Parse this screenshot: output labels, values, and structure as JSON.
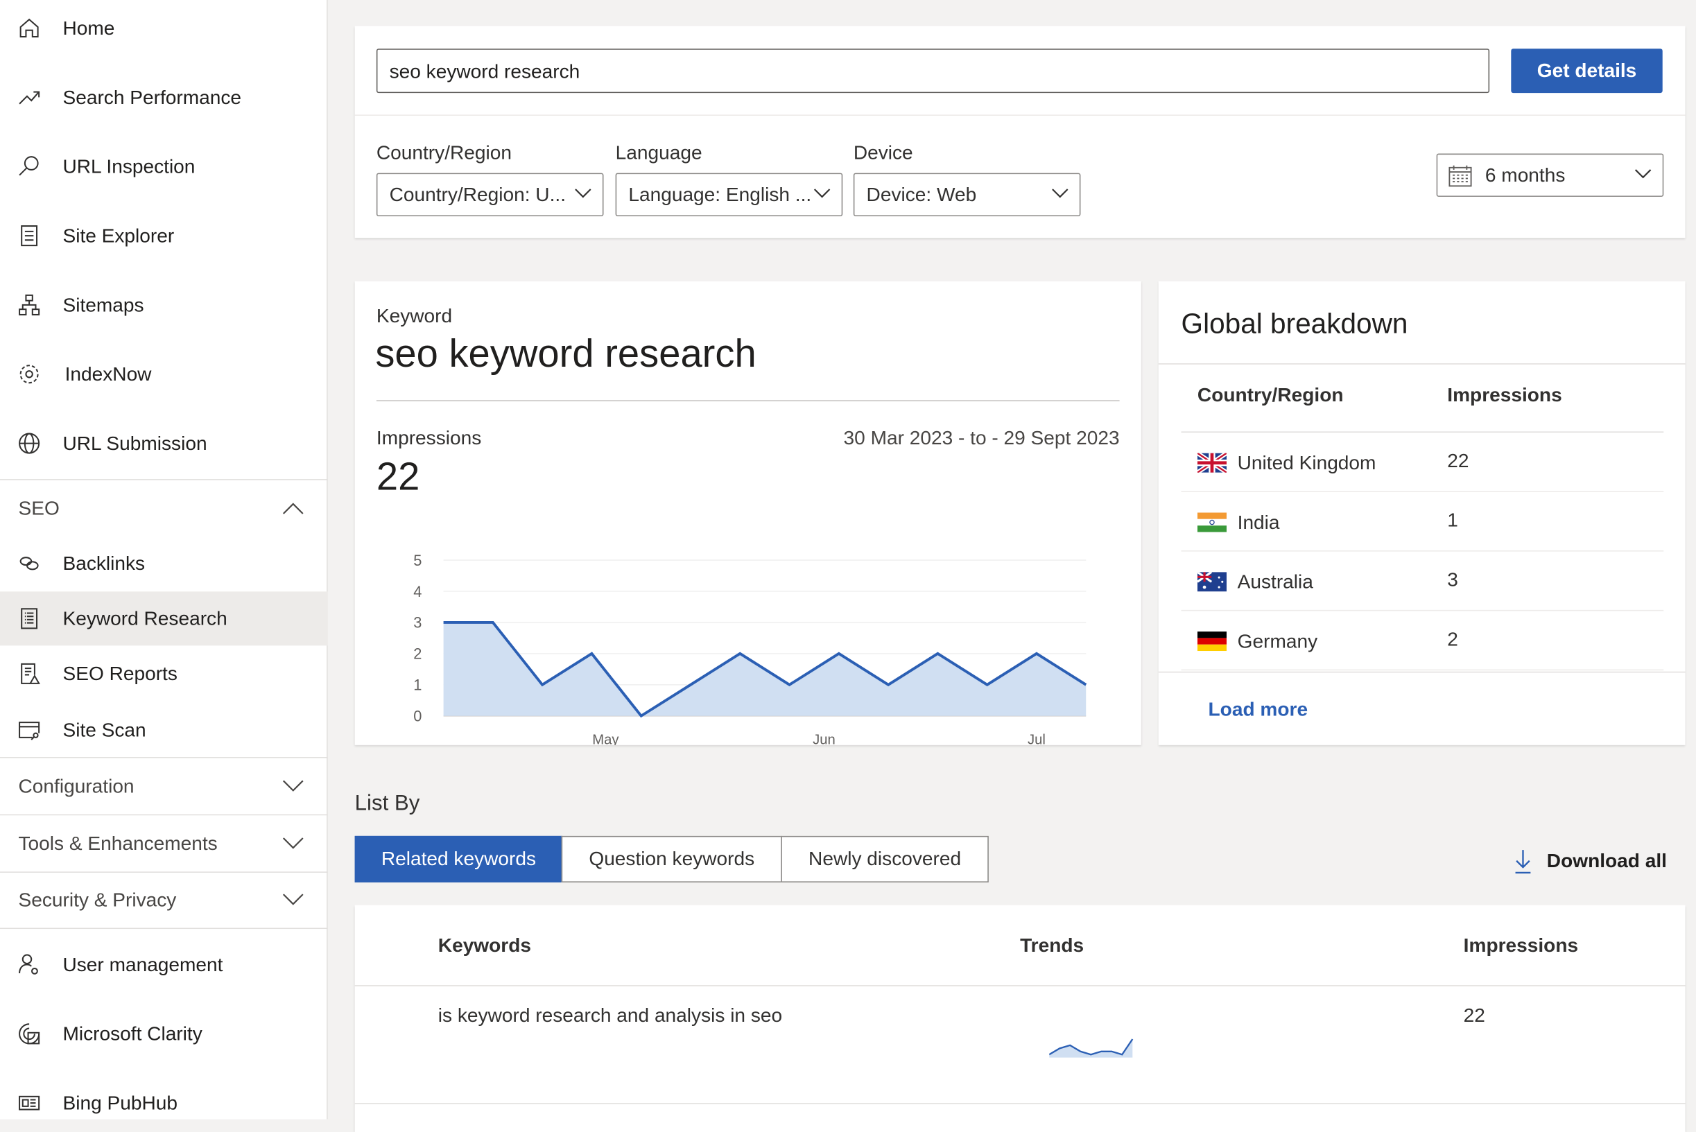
{
  "colors": {
    "accent": "#2b5fb4",
    "chart_line": "#2b5fb4",
    "chart_fill": "#d0dff2",
    "selected_nav": "#edebe9"
  },
  "sidebar": {
    "items": [
      {
        "label": "Home",
        "icon": "home-icon"
      },
      {
        "label": "Search Performance",
        "icon": "trend-icon"
      },
      {
        "label": "URL Inspection",
        "icon": "search-icon"
      },
      {
        "label": "Site Explorer",
        "icon": "document-icon"
      },
      {
        "label": "Sitemaps",
        "icon": "sitemap-icon"
      },
      {
        "label": "IndexNow",
        "icon": "gear-icon"
      },
      {
        "label": "URL Submission",
        "icon": "globe-icon"
      }
    ],
    "seo": {
      "label": "SEO",
      "expanded": true,
      "items": [
        {
          "label": "Backlinks",
          "icon": "link-icon"
        },
        {
          "label": "Keyword Research",
          "icon": "list-icon",
          "selected": true
        },
        {
          "label": "SEO Reports",
          "icon": "report-warning-icon"
        },
        {
          "label": "Site Scan",
          "icon": "scan-icon"
        }
      ]
    },
    "sections": [
      {
        "label": "Configuration"
      },
      {
        "label": "Tools & Enhancements"
      },
      {
        "label": "Security & Privacy"
      }
    ],
    "bottom": [
      {
        "label": "User management",
        "icon": "user-gear-icon"
      },
      {
        "label": "Microsoft Clarity",
        "icon": "clarity-icon"
      },
      {
        "label": "Bing PubHub",
        "icon": "news-icon"
      }
    ]
  },
  "search": {
    "value": "seo keyword research",
    "button": "Get details"
  },
  "filters": {
    "country": {
      "label": "Country/Region",
      "value": "Country/Region: U..."
    },
    "language": {
      "label": "Language",
      "value": "Language: English ..."
    },
    "device": {
      "label": "Device",
      "value": "Device: Web"
    },
    "period": {
      "value": "6 months"
    }
  },
  "keyword_card": {
    "caption": "Keyword",
    "keyword": "seo keyword research",
    "metric_label": "Impressions",
    "metric_value": "22",
    "date_range": "30 Mar 2023 - to - 29 Sept 2023"
  },
  "chart_data": {
    "type": "area",
    "values": [
      3,
      3,
      1,
      2,
      0,
      1,
      2,
      1,
      2,
      1,
      2,
      1,
      2,
      1
    ],
    "y_ticks": [
      "0",
      "1",
      "2",
      "3",
      "4",
      "5"
    ],
    "x_ticks": [
      "May",
      "Jun",
      "Jul"
    ],
    "ylim": [
      0,
      5
    ],
    "grid": true
  },
  "global": {
    "title": "Global breakdown",
    "headers": [
      "Country/Region",
      "Impressions"
    ],
    "rows": [
      {
        "country": "United Kingdom",
        "value": "22",
        "flag": "uk"
      },
      {
        "country": "India",
        "value": "1",
        "flag": "in"
      },
      {
        "country": "Australia",
        "value": "3",
        "flag": "au"
      },
      {
        "country": "Germany",
        "value": "2",
        "flag": "de"
      }
    ],
    "load_more": "Load more"
  },
  "list_by": {
    "label": "List By",
    "tabs": [
      {
        "label": "Related keywords",
        "selected": true
      },
      {
        "label": "Question keywords"
      },
      {
        "label": "Newly discovered"
      }
    ],
    "download": "Download all"
  },
  "table": {
    "headers": [
      "Keywords",
      "Trends",
      "Impressions"
    ],
    "rows": [
      {
        "keyword": "is keyword research and analysis in seo",
        "impressions": "22",
        "trend": [
          1,
          3,
          4,
          2,
          1,
          2,
          2,
          1,
          6
        ]
      }
    ]
  }
}
